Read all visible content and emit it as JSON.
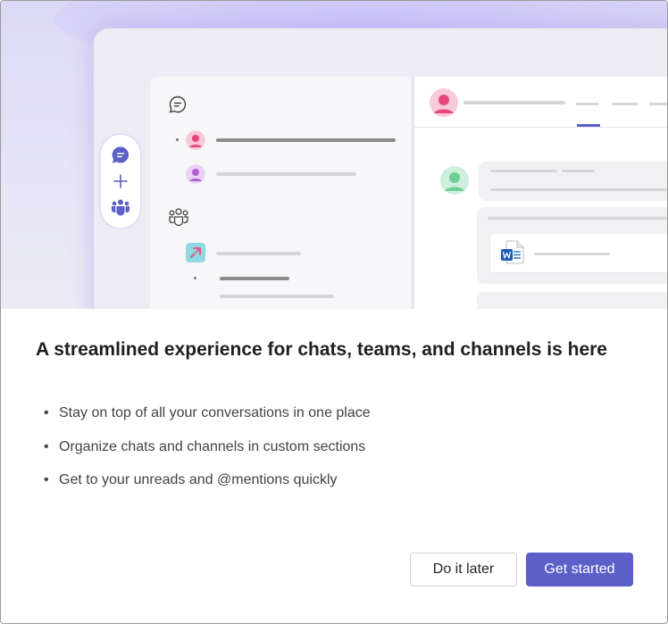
{
  "dialog": {
    "title": "A streamlined experience for chats, teams, and channels is here",
    "bullets": [
      "Stay on top of all your conversations in one place",
      "Organize chats and channels in custom sections",
      "Get to your unreads and @mentions quickly"
    ],
    "secondary_button": "Do it later",
    "primary_button": "Get started"
  },
  "colors": {
    "accent": "#5b5fc7",
    "hero_background": "#e3e1f6",
    "title_text": "#1f1f1f",
    "body_text": "#424242"
  },
  "illustration_icons": [
    "chat-icon",
    "add-icon",
    "teams-icon",
    "word-document-icon"
  ]
}
